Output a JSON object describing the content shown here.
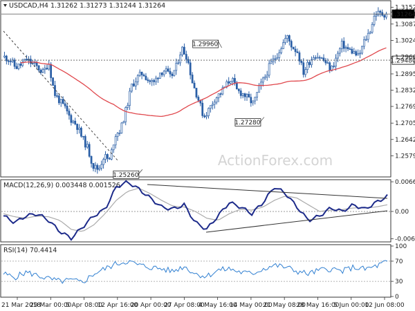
{
  "chart_data": [
    {
      "type": "candlestick",
      "title": "USDCAD,H4 1.31262 1.31273 1.31244 1.31264",
      "watermark": "ActionForex.com",
      "ylim": [
        1.25,
        1.3175
      ],
      "y_ticks": [
        "1.31520",
        "1.30875",
        "1.30245",
        "1.29600",
        "1.28950",
        "1.28325",
        "1.27695",
        "1.27050",
        "1.26420",
        "1.25790"
      ],
      "x_ticks": [
        "21 Mar 2018",
        "29 Mar 00:00",
        "5 Apr 08:00",
        "12 Apr 16:00",
        "20 Apr 00:00",
        "27 Apr 08:00",
        "4 May 16:00",
        "14 May 00:00",
        "21 May 08:00",
        "28 May 16:00",
        "5 Jun 00:00",
        "12 Jun 08:00"
      ],
      "price_path": [
        [
          1.296,
          1.295
        ],
        [
          1.292,
          1.293
        ],
        [
          1.295,
          1.2935
        ],
        [
          1.292,
          1.29
        ],
        [
          1.294,
          1.282
        ],
        [
          1.279,
          1.276
        ],
        [
          1.272,
          1.27
        ],
        [
          1.265,
          1.261
        ],
        [
          1.254,
          1.2526
        ],
        [
          1.258,
          1.256
        ],
        [
          1.266,
          1.268
        ],
        [
          1.276,
          1.285
        ],
        [
          1.288,
          1.29
        ],
        [
          1.287,
          1.286
        ],
        [
          1.29,
          1.291
        ],
        [
          1.288,
          1.292
        ],
        [
          1.2996,
          1.296
        ],
        [
          1.286,
          1.28
        ],
        [
          1.2728,
          1.276
        ],
        [
          1.28,
          1.282
        ],
        [
          1.285,
          1.288
        ],
        [
          1.283,
          1.282
        ],
        [
          1.28,
          1.278
        ],
        [
          1.284,
          1.288
        ],
        [
          1.293,
          1.296
        ],
        [
          1.3,
          1.304
        ],
        [
          1.3,
          1.298
        ],
        [
          1.29,
          1.294
        ],
        [
          1.297,
          1.296
        ],
        [
          1.294,
          1.291
        ],
        [
          1.296,
          1.301
        ],
        [
          1.299,
          1.298
        ],
        [
          1.296,
          1.302
        ],
        [
          1.306,
          1.313
        ],
        [
          1.3126,
          1.3126
        ]
      ],
      "series": [
        {
          "name": "Candles",
          "color": "#2a5fa6"
        },
        {
          "name": "",
          "color": "#e0474c"
        }
      ],
      "levels": [
        {
          "value": 1.2948,
          "label": "1.29480",
          "style": "dotted"
        },
        {
          "value": 1.31264,
          "label": "1.31264",
          "style": "solid"
        }
      ],
      "annotations": [
        {
          "label": "1.29960",
          "x_category": "4 May 16:00",
          "value": 1.2996
        },
        {
          "label": "1.27280",
          "x_category": "14 May 00:00",
          "value": 1.2728
        },
        {
          "label": "1.25260",
          "x_category": "12 Apr 16:00",
          "value": 1.2526
        }
      ]
    },
    {
      "type": "line",
      "title": "MACD(12,26,9) 0.003448 0.001526",
      "ylim": [
        -0.0065,
        0.0068
      ],
      "y_ticks": [
        "0.006639",
        "0.00",
        "-0.006114"
      ],
      "series": [
        {
          "name": "MACD",
          "color": "#1c2a8a",
          "values": [
            -0.001,
            -0.0025,
            -0.001,
            -0.0005,
            -0.002,
            -0.0045,
            -0.006,
            -0.0035,
            -0.001,
            0.0005,
            0.0055,
            0.0066,
            0.005,
            0.003,
            0.001,
            0.0005,
            0.0015,
            -0.0025,
            -0.004,
            -0.001,
            0.002,
            0.001,
            -0.0005,
            0.002,
            0.0055,
            0.004,
            0.001,
            -0.002,
            -0.001,
            0.0008,
            0.0,
            0.0015,
            0.0005,
            0.002,
            0.0034
          ]
        },
        {
          "name": "Signal",
          "color": "#aaaaaa",
          "values": [
            -0.0005,
            -0.0012,
            -0.0015,
            -0.001,
            -0.0012,
            -0.002,
            -0.004,
            -0.0045,
            -0.003,
            -0.0005,
            0.0025,
            0.0045,
            0.0052,
            0.004,
            0.0025,
            0.0012,
            0.001,
            0.0,
            -0.0015,
            -0.002,
            -0.0005,
            0.0005,
            0.0003,
            0.001,
            0.0025,
            0.0035,
            0.003,
            0.0015,
            0.0,
            0.0003,
            0.0004,
            0.0008,
            0.0008,
            0.001,
            0.0015
          ]
        }
      ]
    },
    {
      "type": "line",
      "title": "RSI(14) 70.4414",
      "ylim": [
        0,
        100
      ],
      "y_ticks": [
        "100",
        "70",
        "30",
        "0"
      ],
      "series": [
        {
          "name": "RSI",
          "color": "#2f7fd1",
          "values": [
            45,
            38,
            48,
            42,
            35,
            30,
            32,
            28,
            45,
            55,
            65,
            70,
            62,
            58,
            55,
            50,
            60,
            45,
            40,
            52,
            55,
            48,
            45,
            55,
            62,
            58,
            50,
            45,
            52,
            55,
            50,
            58,
            54,
            60,
            70
          ]
        }
      ]
    }
  ]
}
